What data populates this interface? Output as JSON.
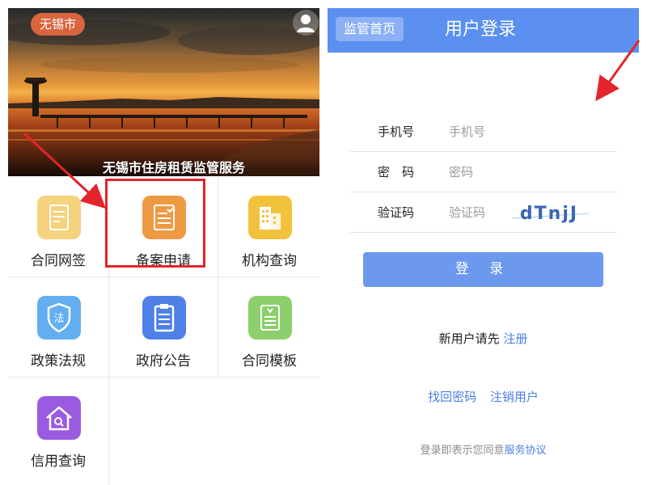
{
  "left_app": {
    "city": "无锡市",
    "banner_caption": "无锡市住房租赁监管服务",
    "menu": [
      {
        "label": "合同网签",
        "icon": "contract-sign-icon",
        "color": "#f5d27e"
      },
      {
        "label": "备案申请",
        "icon": "filing-application-icon",
        "color": "#ee9a43"
      },
      {
        "label": "机构查询",
        "icon": "building-icon",
        "color": "#f1c33d"
      },
      {
        "label": "政策法规",
        "icon": "law-shield-icon",
        "color": "#63aef0"
      },
      {
        "label": "政府公告",
        "icon": "clipboard-icon",
        "color": "#4f80e8"
      },
      {
        "label": "合同模板",
        "icon": "template-document-icon",
        "color": "#8ccf6c"
      },
      {
        "label": "信用查询",
        "icon": "credit-home-icon",
        "color": "#9a5be0"
      }
    ]
  },
  "right_app": {
    "home_button": "监管首页",
    "title": "用户登录",
    "fields": {
      "phone": {
        "label": "手机号",
        "placeholder": "手机号"
      },
      "password": {
        "label": "密　码",
        "placeholder": "密码"
      },
      "captcha": {
        "label": "验证码",
        "placeholder": "验证码",
        "image_text": "dTnjJ"
      }
    },
    "login_button": "登 录",
    "register_prompt": "新用户请先",
    "register_link": "注册",
    "recover_link": "找回密码",
    "cancel_user_link": "注销用户",
    "agreement_prefix": "登录即表示您同意",
    "agreement_link": "服务协议"
  },
  "colors": {
    "accent_blue": "#5b8ff0",
    "highlight_red": "#e3242b",
    "link_blue": "#4a7fe0"
  }
}
